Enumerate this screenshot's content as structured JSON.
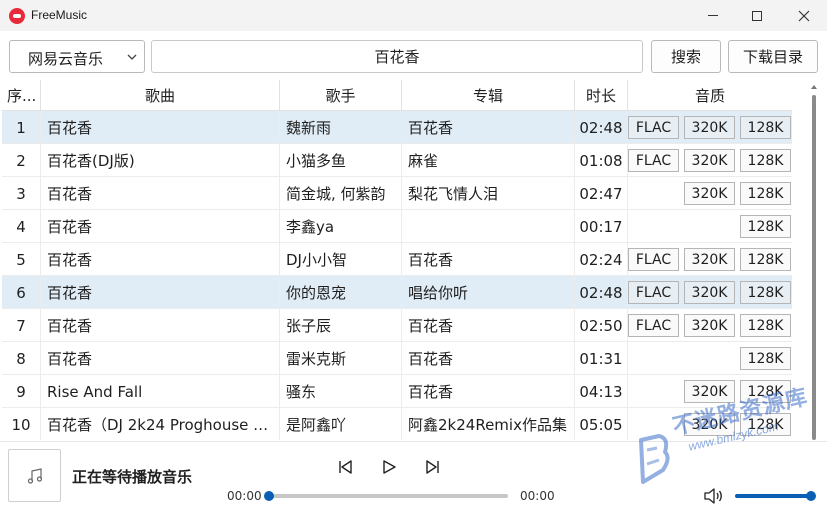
{
  "window": {
    "title": "FreeMusic"
  },
  "toolbar": {
    "source_selected": "网易云音乐",
    "search_value": "百花香",
    "search_label": "搜索",
    "download_dir_label": "下载目录"
  },
  "table": {
    "headers": {
      "index": "序...",
      "song": "歌曲",
      "artist": "歌手",
      "album": "专辑",
      "duration": "时长",
      "quality": "音质"
    },
    "rows": [
      {
        "index": "1",
        "song": "百花香",
        "artist": "魏新雨",
        "album": "百花香",
        "duration": "02:48",
        "flac": "FLAC",
        "q320": "320K",
        "q128": "128K",
        "selected": true
      },
      {
        "index": "2",
        "song": "百花香(DJ版)",
        "artist": "小猫多鱼",
        "album": "麻雀",
        "duration": "01:08",
        "flac": "FLAC",
        "q320": "320K",
        "q128": "128K",
        "selected": false
      },
      {
        "index": "3",
        "song": "百花香",
        "artist": "简金城, 何紫韵",
        "album": "梨花飞情人泪",
        "duration": "02:47",
        "flac": null,
        "q320": "320K",
        "q128": "128K",
        "selected": false
      },
      {
        "index": "4",
        "song": "百花香",
        "artist": "李鑫ya",
        "album": "",
        "duration": "00:17",
        "flac": null,
        "q320": null,
        "q128": "128K",
        "selected": false
      },
      {
        "index": "5",
        "song": "百花香",
        "artist": "DJ小小智",
        "album": "百花香",
        "duration": "02:24",
        "flac": "FLAC",
        "q320": "320K",
        "q128": "128K",
        "selected": false
      },
      {
        "index": "6",
        "song": "百花香",
        "artist": "你的恩宠",
        "album": "唱给你听",
        "duration": "02:48",
        "flac": "FLAC",
        "q320": "320K",
        "q128": "128K",
        "selected": true
      },
      {
        "index": "7",
        "song": "百花香",
        "artist": "张子辰",
        "album": "百花香",
        "duration": "02:50",
        "flac": "FLAC",
        "q320": "320K",
        "q128": "128K",
        "selected": false
      },
      {
        "index": "8",
        "song": "百花香",
        "artist": "雷米克斯",
        "album": "百花香",
        "duration": "01:31",
        "flac": null,
        "q320": null,
        "q128": "128K",
        "selected": false
      },
      {
        "index": "9",
        "song": "Rise And Fall",
        "artist": "骚东",
        "album": "百花香",
        "duration": "04:13",
        "flac": null,
        "q320": "320K",
        "q128": "128K",
        "selected": false
      },
      {
        "index": "10",
        "song": "百花香（DJ 2k24 Proghouse Mix...",
        "artist": "是阿鑫吖",
        "album": "阿鑫2k24Remix作品集",
        "duration": "05:05",
        "flac": null,
        "q320": "320K",
        "q128": "128K",
        "selected": false
      }
    ]
  },
  "player": {
    "status": "正在等待播放音乐",
    "current_time": "00:00",
    "total_time": "00:00",
    "progress": 0,
    "volume": 1.0
  },
  "watermark": {
    "text": "不迷路资源库",
    "url": "www.bmlzyk.com"
  },
  "colors": {
    "accent": "#0a5fb4",
    "selected_row": "#e1edf6",
    "app_icon": "#e8293a"
  }
}
